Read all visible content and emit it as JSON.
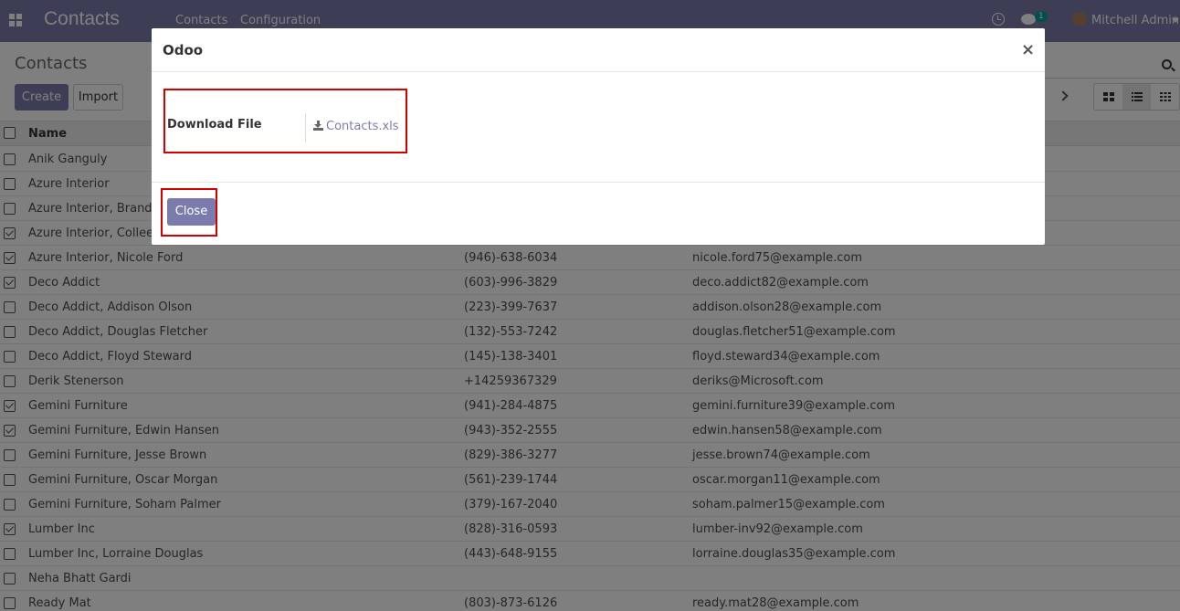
{
  "navbar": {
    "app_title": "Contacts",
    "menu": [
      "Contacts",
      "Configuration"
    ],
    "chat_badge": "1",
    "user_name": "Mitchell Admin"
  },
  "control_panel": {
    "breadcrumb": "Contacts",
    "create_label": "Create",
    "import_label": "Import"
  },
  "list": {
    "header_name": "Name",
    "rows": [
      {
        "name": "Anik Ganguly",
        "phone": "",
        "email": "",
        "checked": false
      },
      {
        "name": "Azure Interior",
        "phone": "",
        "email": "",
        "checked": false
      },
      {
        "name": "Azure Interior, Brandon",
        "phone": "",
        "email": "",
        "checked": false
      },
      {
        "name": "Azure Interior, Colleen D",
        "phone": "",
        "email": "",
        "checked": true
      },
      {
        "name": "Azure Interior, Nicole Ford",
        "phone": "(946)-638-6034",
        "email": "nicole.ford75@example.com",
        "checked": true
      },
      {
        "name": "Deco Addict",
        "phone": "(603)-996-3829",
        "email": "deco.addict82@example.com",
        "checked": true
      },
      {
        "name": "Deco Addict, Addison Olson",
        "phone": "(223)-399-7637",
        "email": "addison.olson28@example.com",
        "checked": false
      },
      {
        "name": "Deco Addict, Douglas Fletcher",
        "phone": "(132)-553-7242",
        "email": "douglas.fletcher51@example.com",
        "checked": false
      },
      {
        "name": "Deco Addict, Floyd Steward",
        "phone": "(145)-138-3401",
        "email": "floyd.steward34@example.com",
        "checked": false
      },
      {
        "name": "Derik Stenerson",
        "phone": "+14259367329",
        "email": "deriks@Microsoft.com",
        "checked": false
      },
      {
        "name": "Gemini Furniture",
        "phone": "(941)-284-4875",
        "email": "gemini.furniture39@example.com",
        "checked": true
      },
      {
        "name": "Gemini Furniture, Edwin Hansen",
        "phone": "(943)-352-2555",
        "email": "edwin.hansen58@example.com",
        "checked": true
      },
      {
        "name": "Gemini Furniture, Jesse Brown",
        "phone": "(829)-386-3277",
        "email": "jesse.brown74@example.com",
        "checked": false
      },
      {
        "name": "Gemini Furniture, Oscar Morgan",
        "phone": "(561)-239-1744",
        "email": "oscar.morgan11@example.com",
        "checked": false
      },
      {
        "name": "Gemini Furniture, Soham Palmer",
        "phone": "(379)-167-2040",
        "email": "soham.palmer15@example.com",
        "checked": false
      },
      {
        "name": "Lumber Inc",
        "phone": "(828)-316-0593",
        "email": "lumber-inv92@example.com",
        "checked": true
      },
      {
        "name": "Lumber Inc, Lorraine Douglas",
        "phone": "(443)-648-9155",
        "email": "lorraine.douglas35@example.com",
        "checked": false
      },
      {
        "name": "Neha Bhatt Gardi",
        "phone": "",
        "email": "",
        "checked": false
      },
      {
        "name": "Ready Mat",
        "phone": "(803)-873-6126",
        "email": "ready.mat28@example.com",
        "checked": false
      }
    ]
  },
  "modal": {
    "title": "Odoo",
    "close_glyph": "×",
    "field_label": "Download File",
    "file_name": "Contacts.xls",
    "close_label": "Close"
  },
  "colors": {
    "brand": "#7c7bad",
    "highlight": "#d40000"
  }
}
